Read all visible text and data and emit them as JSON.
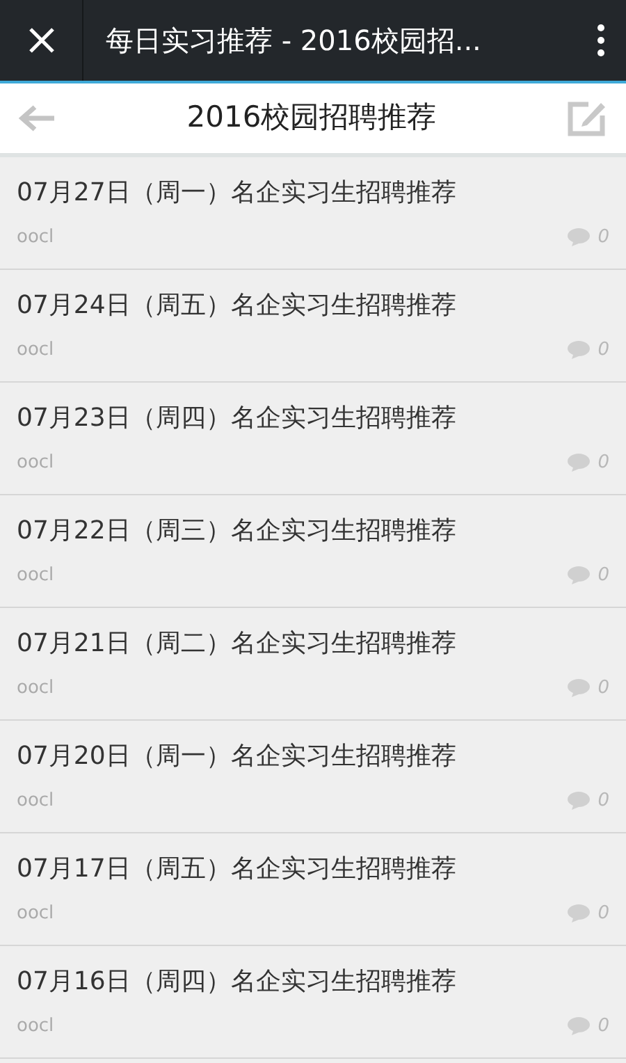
{
  "window": {
    "title": "每日实习推荐 - 2016校园招..."
  },
  "header": {
    "title": "2016校园招聘推荐"
  },
  "posts": [
    {
      "title": "07月27日（周一）名企实习生招聘推荐",
      "author": "oocl",
      "comments": "0"
    },
    {
      "title": "07月24日（周五）名企实习生招聘推荐",
      "author": "oocl",
      "comments": "0"
    },
    {
      "title": "07月23日（周四）名企实习生招聘推荐",
      "author": "oocl",
      "comments": "0"
    },
    {
      "title": "07月22日（周三）名企实习生招聘推荐",
      "author": "oocl",
      "comments": "0"
    },
    {
      "title": "07月21日（周二）名企实习生招聘推荐",
      "author": "oocl",
      "comments": "0"
    },
    {
      "title": "07月20日（周一）名企实习生招聘推荐",
      "author": "oocl",
      "comments": "0"
    },
    {
      "title": "07月17日（周五）名企实习生招聘推荐",
      "author": "oocl",
      "comments": "0"
    },
    {
      "title": "07月16日（周四）名企实习生招聘推荐",
      "author": "oocl",
      "comments": "0"
    }
  ]
}
